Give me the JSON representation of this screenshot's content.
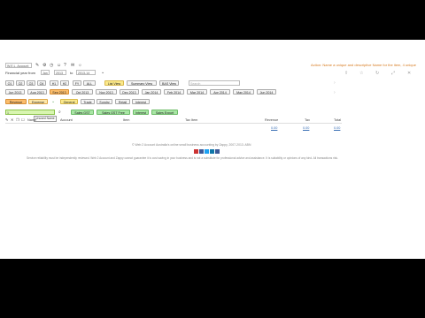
{
  "top_left": {
    "logo_label": "W.E.L. Account"
  },
  "top_right_message": "Action: Name a unique and descriptive Name for the item, 4 unique",
  "financial_year": {
    "label": "Financial year from",
    "from_value": "Jan",
    "year_value": "2013",
    "to_label": "to",
    "to_value": "2013-14"
  },
  "period_buttons": [
    "Q1",
    "Q2",
    "Q3",
    "Q4",
    "H1",
    "H2",
    "FY",
    "ALL"
  ],
  "view_buttons": {
    "list": "List View",
    "summary": "Summary View",
    "bas": "BAS View"
  },
  "search_placeholder": "Search",
  "months": [
    "Jun 2013",
    "Aug 2013",
    "Sep 2013",
    "Oct 2013",
    "Nov 2013",
    "Dec 2013",
    "Jan 2014",
    "Feb 2014",
    "Mar 2014",
    "Apr 2014",
    "May 2014",
    "Jun 2014"
  ],
  "type_tabs": {
    "revenue": "Revenue",
    "expense": "Expense"
  },
  "category_tabs": [
    "General",
    "Trade",
    "Sundry",
    "Retail",
    "Interest"
  ],
  "entry": {
    "value": "1",
    "tooltip": "Unused Name",
    "buttons": [
      "Sales GST",
      "Sales GST Free",
      "Interest",
      "Sales Export"
    ]
  },
  "table": {
    "headers": [
      "Name",
      "Account",
      "Item",
      "Tax Item",
      "Revenue",
      "Tax",
      "Total"
    ],
    "totals": {
      "revenue": "0.00",
      "tax": "0.00",
      "total": "0.00"
    }
  },
  "footer": {
    "copyright": "© Web 2 Account Australia's online small business accounting by Zappy, 2007-2013. ABN",
    "disclaimer": "Service reliability must be independently reviewed. Web 2 Account and Zappy cannot guarantee it is cost saving in your business and is not a substitute for professional advice and assistance. It is suitability or opinions of any kind. All transactions risk."
  },
  "colors": {
    "accent_yellow": "#fbe98c",
    "accent_green": "#a8e6a4",
    "accent_orange": "#fbbd6c",
    "message_orange": "#d77a1f"
  }
}
